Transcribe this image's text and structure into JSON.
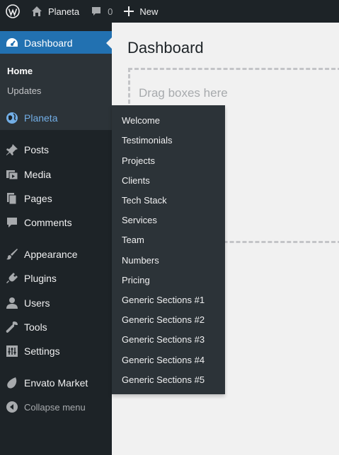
{
  "adminbar": {
    "site_name": "Planeta",
    "comments_count": "0",
    "new_label": "New"
  },
  "sidebar": {
    "dashboard": "Dashboard",
    "dashboard_sub": [
      "Home",
      "Updates"
    ],
    "planeta": "Planeta",
    "posts": "Posts",
    "media": "Media",
    "pages": "Pages",
    "comments": "Comments",
    "appearance": "Appearance",
    "plugins": "Plugins",
    "users": "Users",
    "tools": "Tools",
    "settings": "Settings",
    "envato": "Envato Market",
    "collapse": "Collapse menu"
  },
  "flyout": {
    "items": [
      "Welcome",
      "Testimonials",
      "Projects",
      "Clients",
      "Tech Stack",
      "Services",
      "Team",
      "Numbers",
      "Pricing",
      "Generic Sections #1",
      "Generic Sections #2",
      "Generic Sections #3",
      "Generic Sections #4",
      "Generic Sections #5"
    ]
  },
  "main": {
    "title": "Dashboard",
    "drop_text": "Drag boxes here"
  },
  "colors": {
    "accent": "#2271b1",
    "sidebar_bg": "#1d2327",
    "submenu_bg": "#2c3338",
    "active_link": "#72aee6"
  }
}
